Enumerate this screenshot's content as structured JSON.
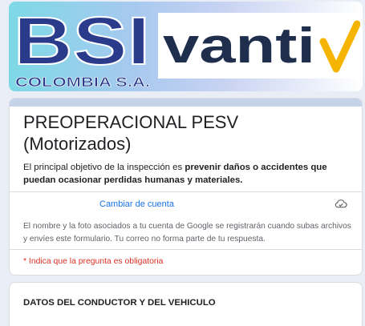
{
  "banner": {
    "bsi_text": "BSI",
    "bsi_sub": "COLOMBIA S.A.",
    "vanti_text": "vanti",
    "colors": {
      "bsi_blue": "#2b3b8c",
      "vanti_navy": "#1f2e4d",
      "vanti_check": "#f5b400"
    }
  },
  "form": {
    "title_line1": "PREOPERACIONAL PESV",
    "title_line2": "(Motorizados)",
    "description_plain": "El principal objetivo de la inspección es ",
    "description_bold": "prevenir daños o accidentes que puedan ocasionar perdidas humanas y materiales.",
    "switch_account": "Cambiar de cuenta",
    "cloud_icon": "cloud-check-icon",
    "notice": "El nombre y la foto asociados a tu cuenta de Google se registrarán cuando subas archivos y envíes este formulario. Tu correo no forma parte de tu respuesta.",
    "required_note": "* Indica que la pregunta es obligatoria"
  },
  "section": {
    "title": "DATOS DEL CONDUCTOR Y DEL VEHICULO"
  }
}
